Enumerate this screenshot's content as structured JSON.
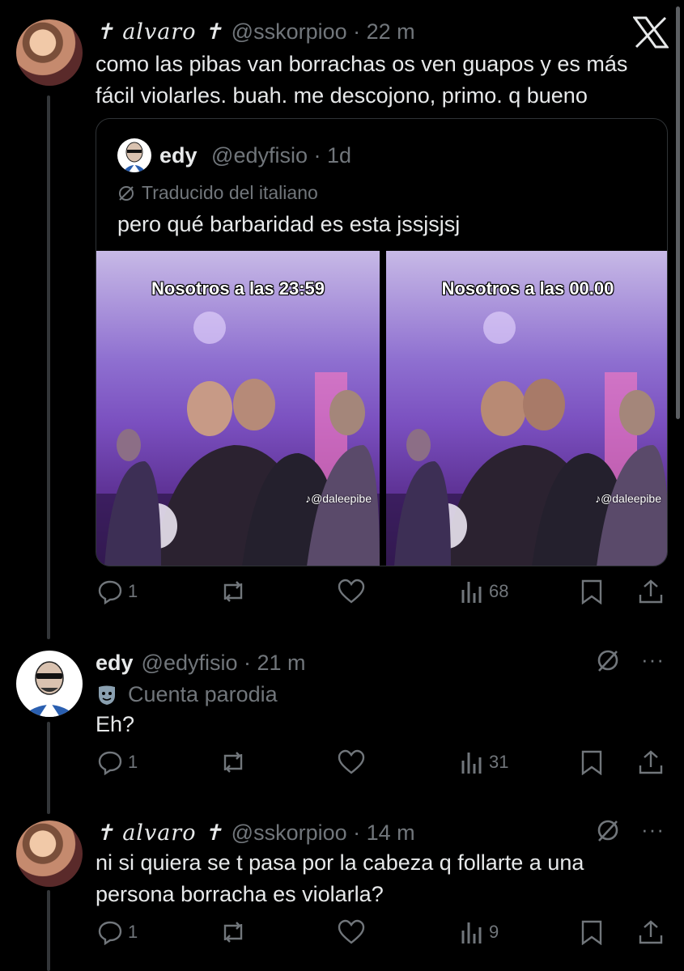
{
  "tweet1": {
    "name": "✝ alvaro ✝",
    "handle": "@sskorpioo · 22 m",
    "text": "como las pibas van borrachas os ven guapos y es más fácil violarles. buah. me descojono, primo. q bueno",
    "quote": {
      "name": "edy",
      "handle": "@edyfisio · 1d",
      "translated": "Traducido del italiano",
      "text": "pero qué barbaridad es esta jssjsjsj",
      "media_left_caption": "Nosotros a las 23:59",
      "media_right_caption": "Nosotros a las 00.00",
      "media_tag_left": "♪@daleepibe",
      "media_tag_right": "♪@daleepibe"
    },
    "actions": {
      "replies": "1",
      "views": "68"
    }
  },
  "tweet2": {
    "name": "edy",
    "handle": "@edyfisio · 21 m",
    "badge": "Cuenta parodia",
    "text": "Eh?",
    "actions": {
      "replies": "1",
      "views": "31"
    }
  },
  "tweet3": {
    "name": "✝ alvaro ✝",
    "handle": "@sskorpioo · 14 m",
    "text": "ni si quiera se t pasa por la cabeza q follarte a una persona borracha es violarla?",
    "actions": {
      "replies": "1",
      "views": "9"
    }
  },
  "icons": {
    "close": "x-logo-icon",
    "reply": "reply-icon",
    "retweet": "retweet-icon",
    "like": "heart-icon",
    "views": "views-icon",
    "bookmark": "bookmark-icon",
    "share": "share-icon",
    "more": "more-icon",
    "grok": "grok-icon",
    "translate": "translate-icon",
    "parody": "parody-mask-icon"
  },
  "colors": {
    "bg": "#000000",
    "text": "#e7e9ea",
    "muted": "#71767b",
    "border": "#2f3336"
  }
}
